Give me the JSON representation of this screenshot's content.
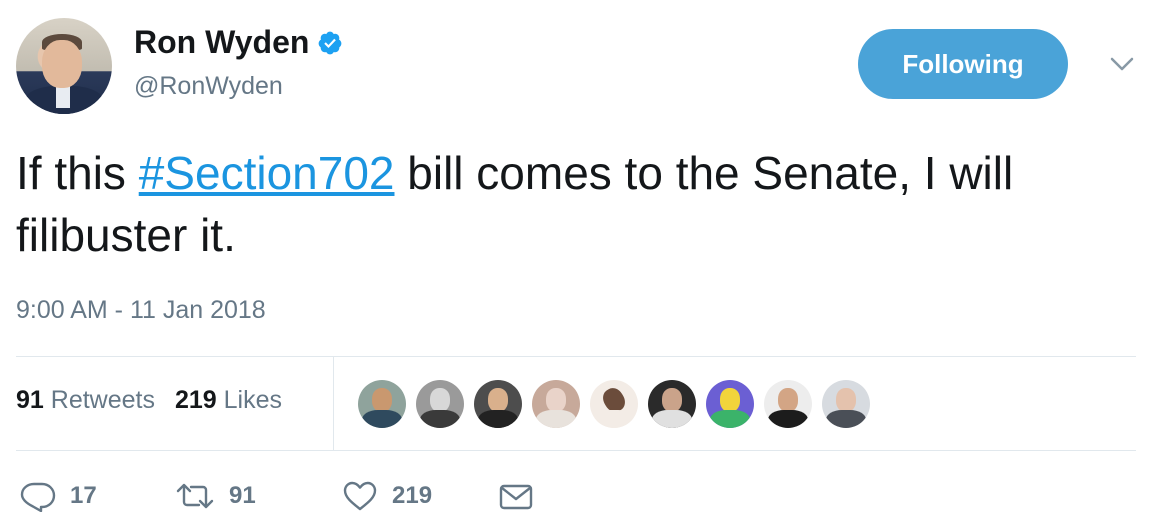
{
  "user": {
    "name": "Ron Wyden",
    "handle": "@RonWyden"
  },
  "follow_button": {
    "label": "Following"
  },
  "tweet": {
    "text_before": "If this ",
    "hashtag": "#Section702",
    "text_after": " bill comes to the Senate, I will filibuster it.",
    "timestamp": "9:00 AM - 11 Jan 2018"
  },
  "stats": {
    "retweets_count": "91",
    "retweets_label": "Retweets",
    "likes_count": "219",
    "likes_label": "Likes"
  },
  "actions": {
    "reply_count": "17",
    "retweet_count": "91",
    "like_count": "219"
  },
  "colors": {
    "accent": "#4aa3d8",
    "link": "#1b95e0",
    "secondary_text": "#657786",
    "divider": "#e1e8ed"
  },
  "icons": [
    "verified-badge-icon",
    "chevron-down-icon",
    "reply-icon",
    "retweet-icon",
    "like-icon",
    "direct-message-icon"
  ]
}
